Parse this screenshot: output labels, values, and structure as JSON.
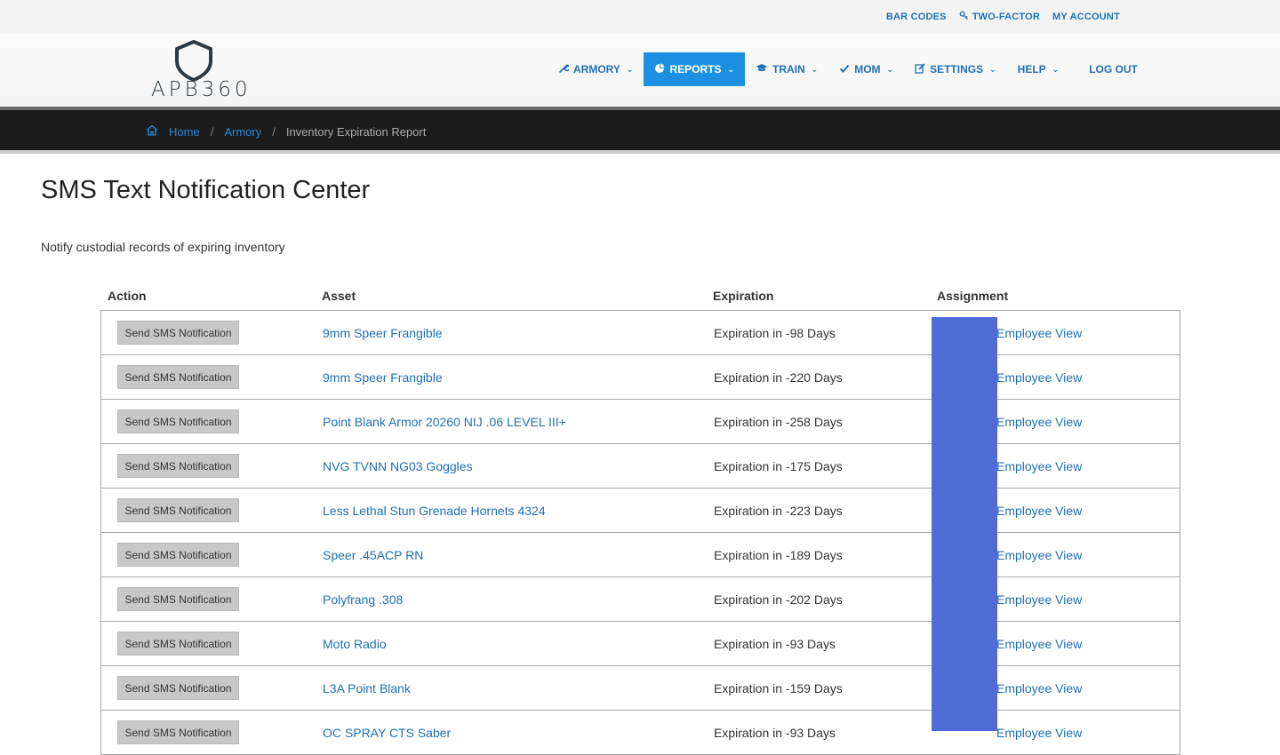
{
  "utility_nav": [
    {
      "label": "BAR CODES",
      "icon": ""
    },
    {
      "label": "TWO-FACTOR",
      "icon": "key-icon"
    },
    {
      "label": "MY ACCOUNT",
      "icon": ""
    }
  ],
  "logo": {
    "text": "APB360"
  },
  "main_nav": [
    {
      "label": "ARMORY",
      "icon": "wrench-icon",
      "dropdown": true,
      "active": false
    },
    {
      "label": "REPORTS",
      "icon": "pie-chart-icon",
      "dropdown": true,
      "active": true
    },
    {
      "label": "TRAIN",
      "icon": "graduation-cap-icon",
      "dropdown": true,
      "active": false
    },
    {
      "label": "MOM",
      "icon": "check-icon",
      "dropdown": true,
      "active": false
    },
    {
      "label": "SETTINGS",
      "icon": "edit-icon",
      "dropdown": true,
      "active": false
    },
    {
      "label": "HELP",
      "icon": "",
      "dropdown": true,
      "active": false
    },
    {
      "label": "LOG OUT",
      "icon": "",
      "dropdown": false,
      "active": false
    }
  ],
  "breadcrumb": {
    "home": "Home",
    "armory": "Armory",
    "current": "Inventory Expiration Report"
  },
  "page": {
    "title": "SMS Text Notification Center",
    "subtitle": "Notify custodial records of expiring inventory"
  },
  "table": {
    "headers": {
      "action": "Action",
      "asset": "Asset",
      "expiration": "Expiration",
      "assignment": "Assignment"
    },
    "button_label": "Send SMS Notification",
    "rows": [
      {
        "asset": "9mm Speer Frangible",
        "expiration": "Expiration in -98 Days",
        "assignment": "Employee View"
      },
      {
        "asset": "9mm Speer Frangible",
        "expiration": "Expiration in -220 Days",
        "assignment": "Employee View"
      },
      {
        "asset": "Point Blank Armor 20260 NIJ .06 LEVEL III+",
        "expiration": "Expiration in -258 Days",
        "assignment": "Employee View"
      },
      {
        "asset": "NVG TVNN NG03 Goggles",
        "expiration": "Expiration in -175 Days",
        "assignment": "Employee View"
      },
      {
        "asset": "Less Lethal Stun Grenade Hornets 4324",
        "expiration": "Expiration in -223 Days",
        "assignment": "Employee View"
      },
      {
        "asset": "Speer .45ACP RN",
        "expiration": "Expiration in -189 Days",
        "assignment": "Employee View"
      },
      {
        "asset": "Polyfrang .308",
        "expiration": "Expiration in -202 Days",
        "assignment": "Employee View"
      },
      {
        "asset": "Moto Radio",
        "expiration": "Expiration in -93 Days",
        "assignment": "Employee View"
      },
      {
        "asset": "L3A Point Blank",
        "expiration": "Expiration in -159 Days",
        "assignment": "Employee View"
      },
      {
        "asset": "OC SPRAY CTS Saber",
        "expiration": "Expiration in -93 Days",
        "assignment": "Employee View"
      }
    ]
  },
  "colors": {
    "link": "#1f6fb5",
    "active_nav": "#1d8fe0",
    "breadcrumb_bg": "#1c1c1c",
    "redaction": "#4f6bd6"
  }
}
